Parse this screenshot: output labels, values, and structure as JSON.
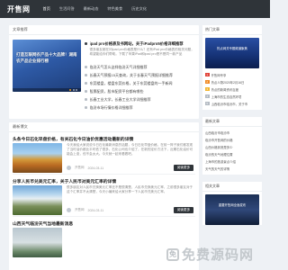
{
  "header": {
    "logo": "开售网",
    "nav": [
      "首页",
      "生活问答",
      "最新动态",
      "特色美食",
      "历史文化"
    ]
  },
  "hot": {
    "heading": "文章推荐",
    "image_caption": "打造互联网农产品十大品牌！湖南农产品企业排行榜",
    "lead_title": "ipad pro价格表及书网站，关于iPadpro5价格详细推荐",
    "lead_desc": "很多朋友都在问ipad pro价格表是什么？还有iPad pro价格表的相关问题，希望能给你们帮助。下载了苹果iPad和ipad pro是不是同一款产品",
    "items": [
      "临汾天气怎么这样临汾天气详细推荐",
      "长春天气预报15天查询，关于长春天气预报详细推荐",
      "东莞楼盘，楼盘东莞价格，关于东莞楼盘的一手新闻",
      "股票配资，股市配资平台都有哪些",
      "长春工业大学，长春工业大学详细推荐",
      "临汾市场行情价格详细推荐"
    ]
  },
  "latest": {
    "heading": "最新博文",
    "articles": [
      {
        "title": "头条今日石化早盘价格，有关石化今日油价优惠活动最新的详情",
        "desc": "今天我给大家说说今日石化最新消息的话题，今日石化早盘价格，在前一阵子我们都发现了当时油价都比平时低了很多，石化公司也介绍了，在新的定价方法下，近期石化油价可能会上涨，但不会太大。今天就一起来看看吧。",
        "author": "开售网",
        "date": "2024-03-11",
        "button": "阅读更多"
      },
      {
        "title": "分享人民币兑美元汇率，关于人民币对美元汇率的详情",
        "desc": "很多朋友对人民币兑换美元汇率还不是很清楚，人民币兑换美元汇率，之前很多朋友对于这个汇率并不太清楚，今天小编来给大家分享一下人民币兑美元汇率。",
        "author": "开售网",
        "date": "2024-03-11",
        "button": "阅读更多"
      },
      {
        "title": "山西天气临汾天气当地最新消息",
        "desc": "",
        "author": "",
        "date": "",
        "button": ""
      }
    ]
  },
  "sidebar": {
    "card1_heading": "热门文章",
    "card1_caption": "热点网关专题频道聚焦",
    "rank": [
      "开售网专享",
      "热点人物2020年2月16日",
      "热点的新闻资讯百度",
      "上海市的生态自然环境",
      "山西临汾市临汾市，关于市"
    ],
    "card2_heading": "最新文章",
    "recent": [
      "山西临汾市临汾市",
      "临汾市开售网的价格",
      "山西价格到底是多少",
      "临汾的天气地理位置",
      "上海市的旅游景点介绍",
      "天气的天气的详情"
    ],
    "card3_heading": "相关文章",
    "card3_caption": "重要开售网全面发布"
  },
  "watermark": {
    "icon": "免",
    "text": "免费源码网"
  },
  "colors": {
    "header_bg": "#2f3439",
    "page_bg": "#eef1f5",
    "rank1": "#e0443a",
    "rank2": "#f08a24",
    "rank3": "#f2b632"
  }
}
